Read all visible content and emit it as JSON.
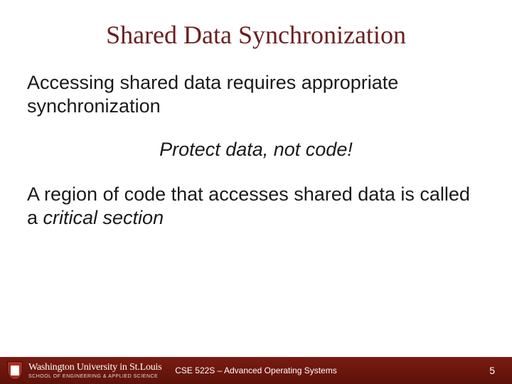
{
  "title": "Shared Data Synchronization",
  "body": {
    "p1": "Accessing shared data requires appropriate synchronization",
    "emph": "Protect data, not code!",
    "p2_pre": "A region of code that accesses shared data is called a ",
    "p2_term": "critical section"
  },
  "footer": {
    "logo_top": "Washington University in St.Louis",
    "logo_bottom": "SCHOOL OF ENGINEERING & APPLIED SCIENCE",
    "course": "CSE 522S – Advanced Operating Systems",
    "page": "5"
  }
}
